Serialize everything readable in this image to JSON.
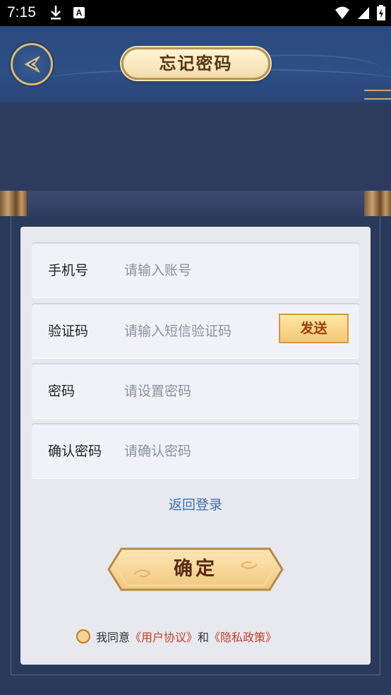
{
  "status_bar": {
    "time": "7:15"
  },
  "header": {
    "title": "忘记密码"
  },
  "form": {
    "phone": {
      "label": "手机号",
      "placeholder": "请输入账号"
    },
    "code": {
      "label": "验证码",
      "placeholder": "请输入短信验证码",
      "send_label": "发送"
    },
    "password": {
      "label": "密码",
      "placeholder": "请设置密码"
    },
    "confirm_password": {
      "label": "确认密码",
      "placeholder": "请确认密码"
    }
  },
  "back_to_login": "返回登录",
  "confirm_button": "确定",
  "agreement": {
    "prefix": "我同意",
    "user_agreement": "《用户协议》",
    "and": "和",
    "privacy_policy": "《隐私政策》"
  },
  "colors": {
    "accent_gold": "#c9a96b",
    "link_blue": "#3d6fb0",
    "link_red": "#c2402a"
  }
}
